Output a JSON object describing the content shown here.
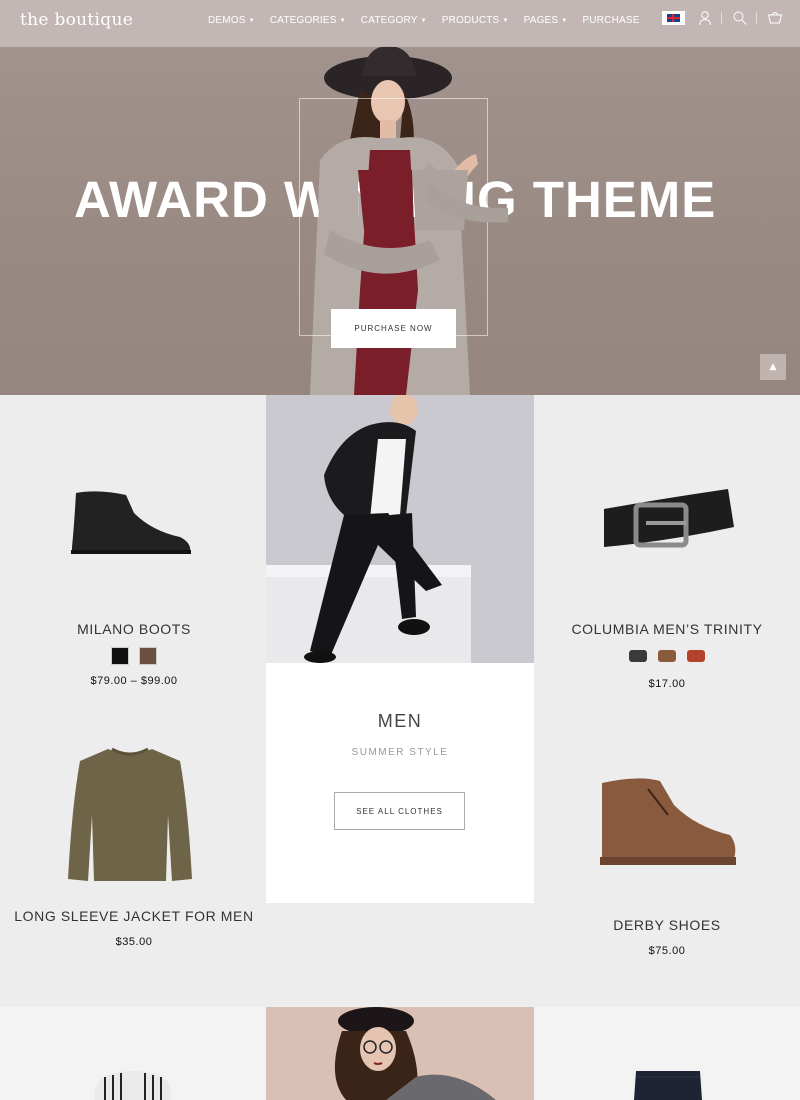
{
  "header": {
    "logo": "the boutique",
    "nav": [
      {
        "label": "DEMOS",
        "has_dropdown": true
      },
      {
        "label": "CATEGORIES",
        "has_dropdown": true
      },
      {
        "label": "CATEGORY",
        "has_dropdown": true
      },
      {
        "label": "PRODUCTS",
        "has_dropdown": true
      },
      {
        "label": "PAGES",
        "has_dropdown": true
      },
      {
        "label": "PURCHASE",
        "has_dropdown": false
      }
    ],
    "icons": [
      "uk-flag-icon",
      "user-icon",
      "search-icon",
      "cart-icon"
    ]
  },
  "hero": {
    "title": "AWARD WINNING THEME",
    "button": "PURCHASE NOW"
  },
  "products": [
    {
      "name": "MILANO BOOTS",
      "price": "$79.00 – $99.00",
      "swatches": [
        "#111111",
        "#6b5040"
      ]
    },
    {
      "name": "COLUMBIA MEN’S TRINITY",
      "price": "$17.00",
      "swatches": [
        "#3a3a3a",
        "#8a5a3a",
        "#b5432c"
      ]
    },
    {
      "name": "LONG SLEEVE JACKET FOR MEN",
      "price": "$35.00"
    },
    {
      "name": "DERBY SHOES",
      "price": "$75.00"
    }
  ],
  "category": {
    "title": "MEN",
    "subtitle": "SUMMER STYLE",
    "button": "SEE ALL CLOTHES"
  },
  "colors": {
    "hero_bg": "#9a8a84",
    "grid_bg": "#ededed",
    "header_bg": "#c6bcba"
  }
}
